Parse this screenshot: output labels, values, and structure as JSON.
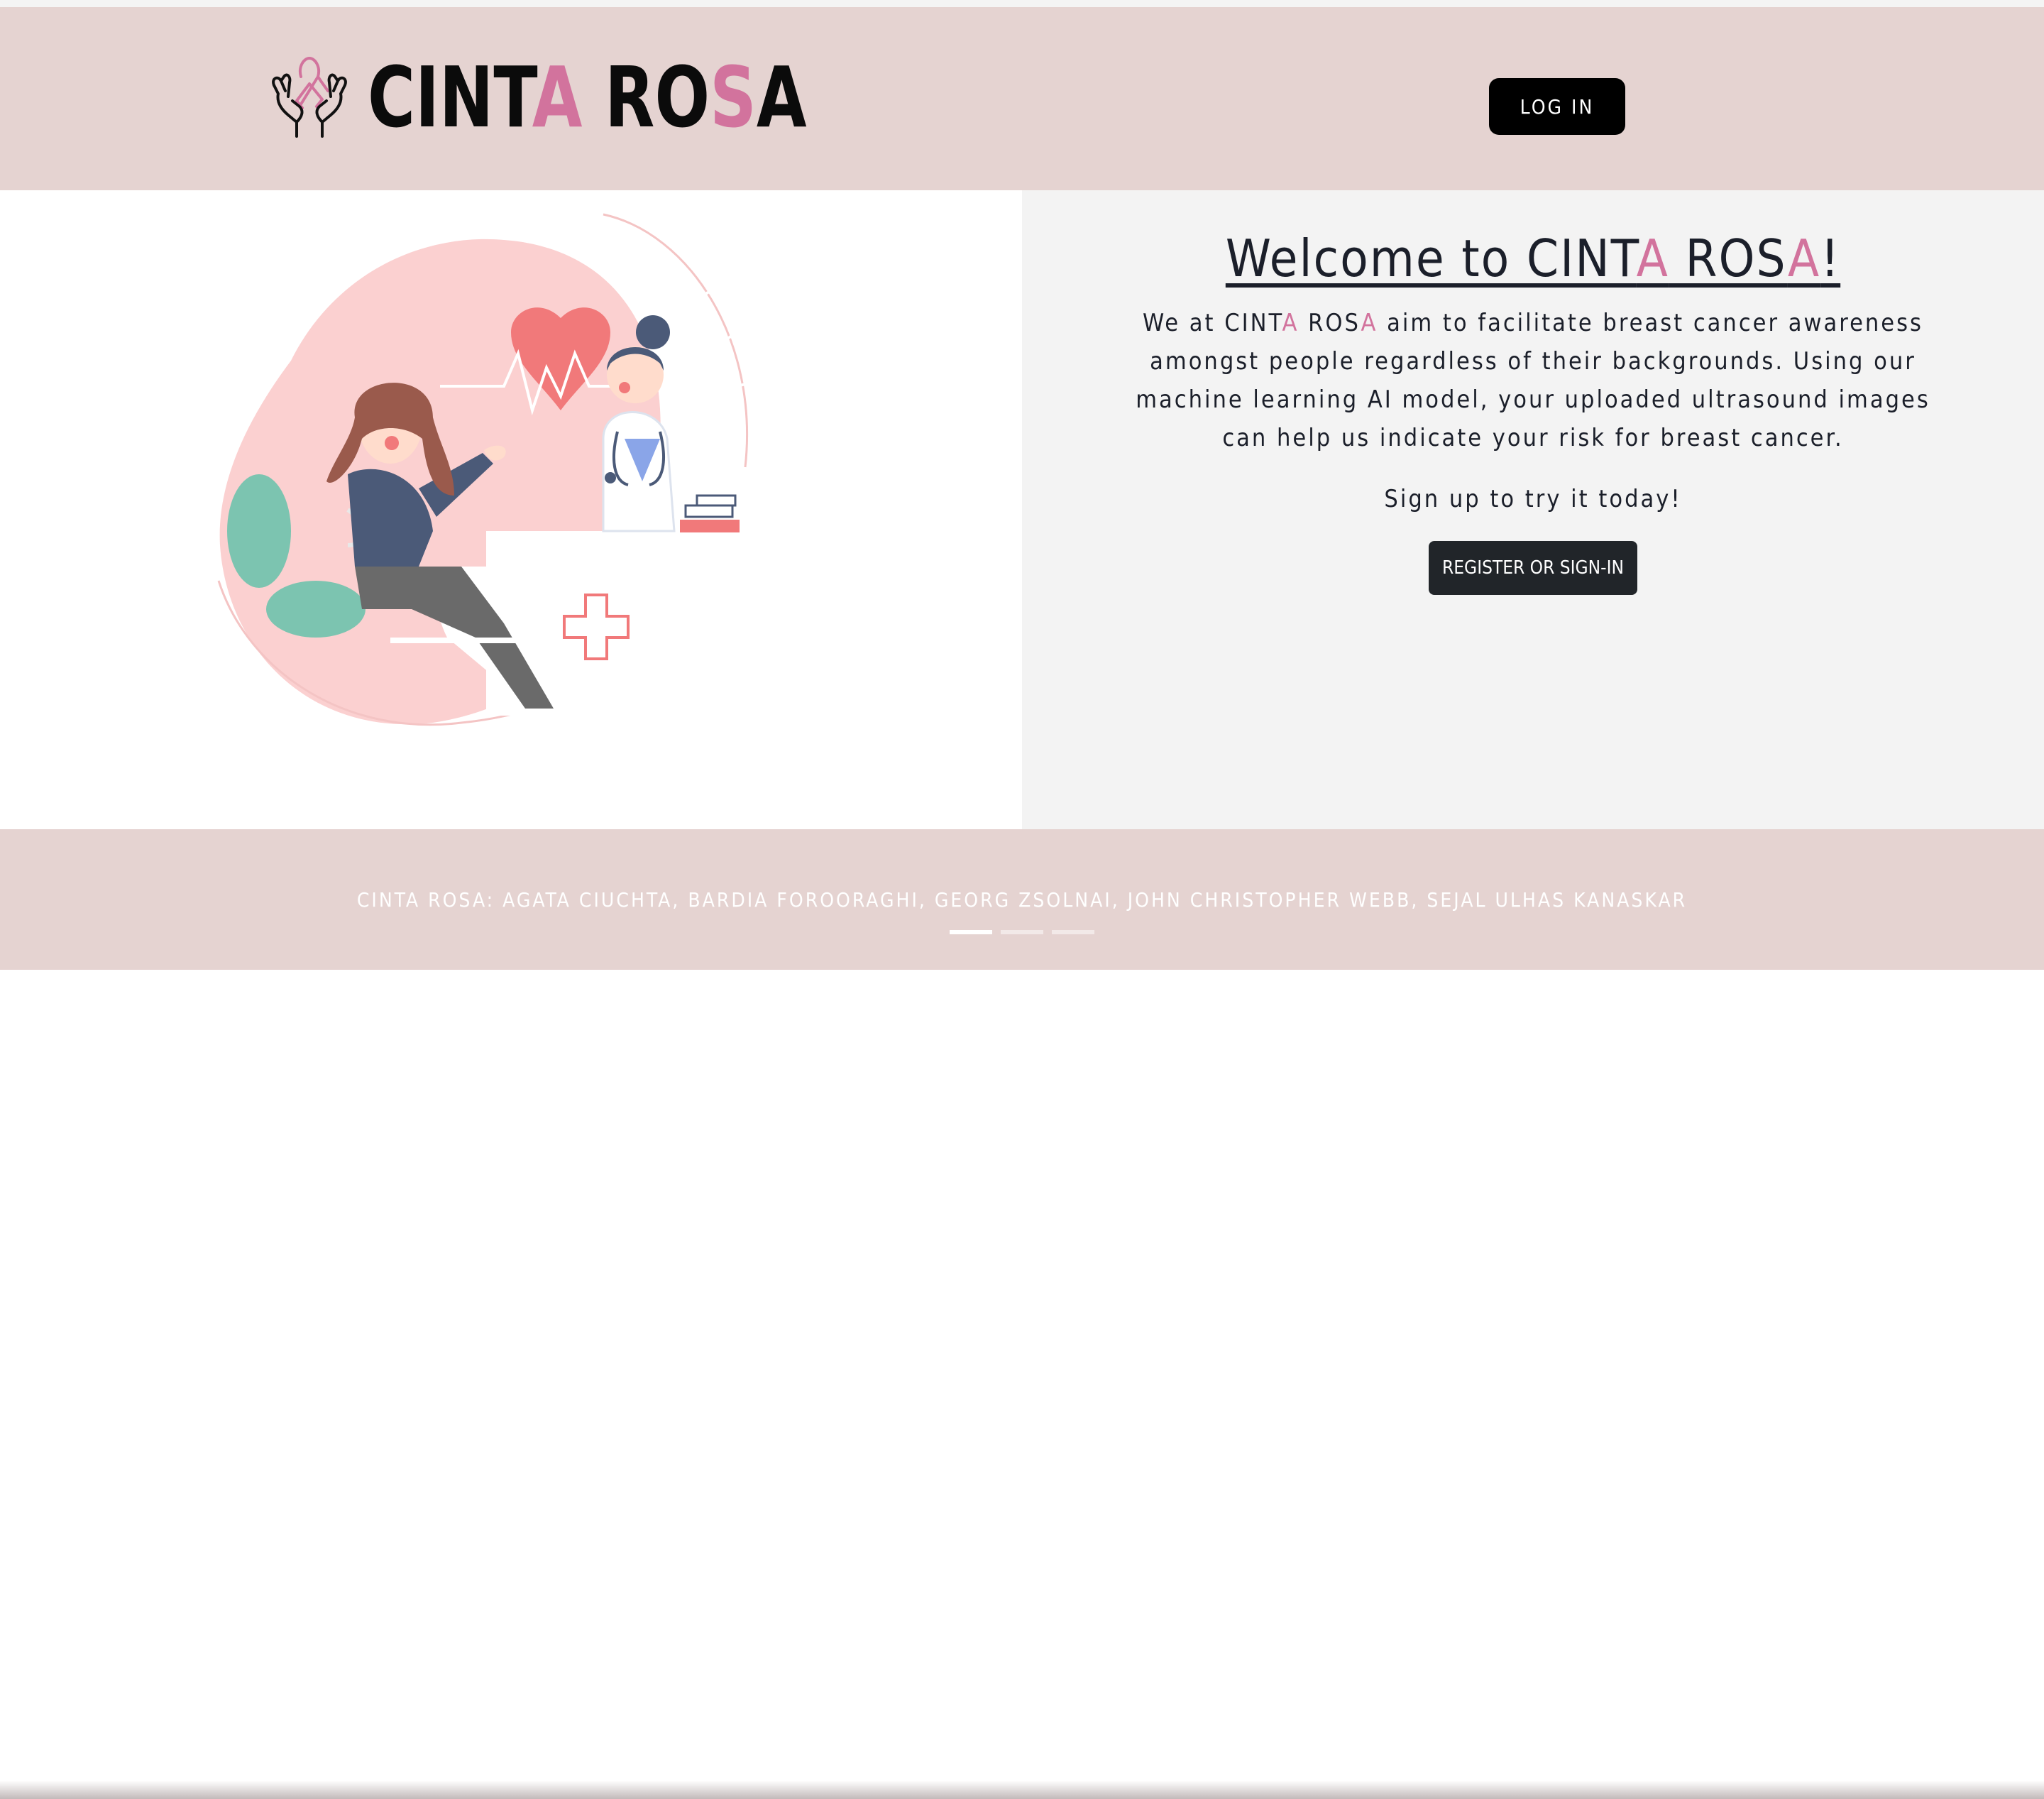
{
  "header": {
    "brand": {
      "pre": "CINT",
      "a1": "A",
      "mid": " RO",
      "s": "S",
      "end": "A"
    },
    "login_label": "LOG IN"
  },
  "hero": {
    "title": {
      "pre": "Welcome to CINT",
      "a1": "A",
      "mid": " ROS",
      "a2": "A",
      "end": "!"
    },
    "about": {
      "pre": "We at CINT",
      "a1": "A",
      "mid": " ROS",
      "a2": "A",
      "rest": " aim to facilitate breast cancer awareness amongst people regardless of their backgrounds. Using our machine learning AI model, your uploaded ultrasound images can help us indicate your risk for breast cancer."
    },
    "cta": "Sign up to try it today!",
    "register_label": "REGISTER OR SIGN-IN"
  },
  "footer": {
    "credits": "CINTA ROSA: AGATA CIUCHTA, BARDIA FOROORAGHI, GEORG ZSOLNAI, JOHN CHRISTOPHER WEBB, SEJAL ULHAS KANASKAR",
    "slides": 3,
    "active_slide": 1
  },
  "colors": {
    "header_bg": "#e5d3d1",
    "accent_pink": "#d2739d",
    "button_dark": "#212529"
  },
  "icons": [
    "ribbon-hands-logo",
    "hero-illustration"
  ]
}
